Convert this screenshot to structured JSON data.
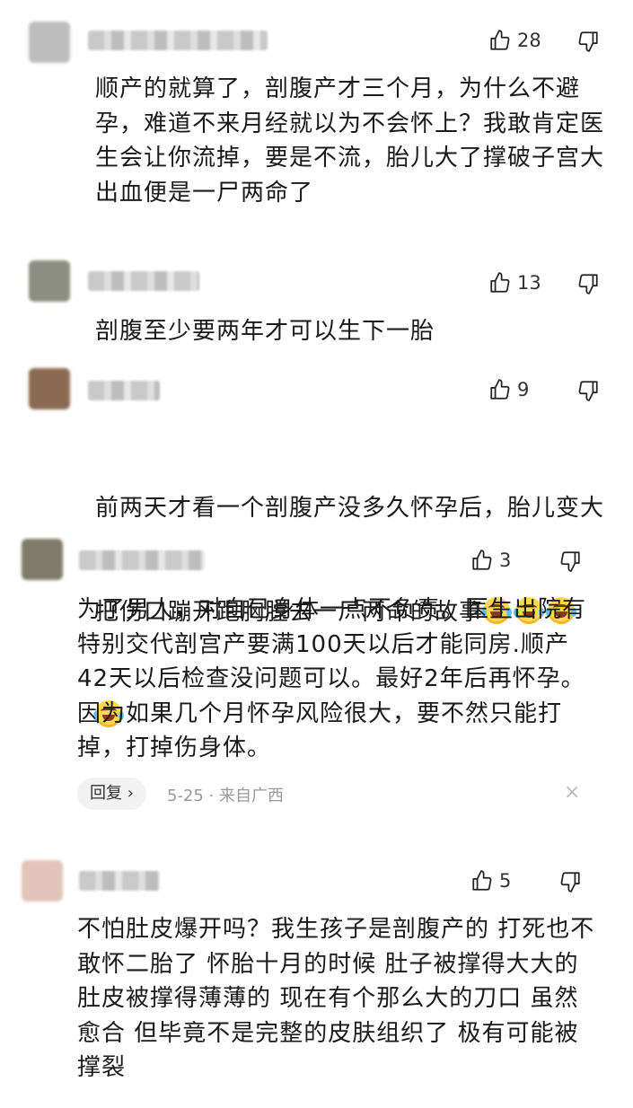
{
  "comments": [
    {
      "likes": "28",
      "text": "顺产的就算了，剖腹产才三个月，为什么不避\n孕，难道不来月经就以为不会怀上？我敢肯定医\n生会让你流掉，要是不流，胎儿大了撑破子宫大\n出血便是一尸两命了",
      "colors": {
        "avatar": "#bdbdbd"
      }
    },
    {
      "likes": "13",
      "text": "剖腹至少要两年才可以生下一胎",
      "colors": {
        "avatar": "#8c8f82"
      }
    },
    {
      "likes": "9",
      "text_line1": "前两天才看一个剖腹产没多久怀孕后，胎儿变大",
      "text_line2": "把伤口蹦开跑胸膛去一尸两命的故事",
      "emoji_icon": "crying-laughing-emoji-icon",
      "colors": {
        "avatar": "#8a6a52"
      }
    },
    {
      "likes": "3",
      "text": "为了男人，对自已身体一点不负责。医生出院有\n特别交代剖宫产要满100天以后才能同房.顺产\n42天以后检查没问题可以。最好2年后再怀孕。\n因为如果几个月怀孕风险很大，要不然只能打\n掉，打掉伤身体。",
      "reply_label": "回复 ›",
      "meta": "5-25 · 来自广西",
      "close_glyph": "×",
      "colors": {
        "avatar": "#7f7a6c"
      }
    },
    {
      "likes": "5",
      "text": "不怕肚皮爆开吗？我生孩子是剖腹产的 打死也不\n敢怀二胎了 怀胎十月的时候 肚子被撑得大大的\n肚皮被撑得薄薄的 现在有个那么大的刀口 虽然\n愈合 但毕竟不是完整的皮肤组织了 极有可能被\n撑裂",
      "colors": {
        "avatar": "#e2c4b8"
      }
    }
  ],
  "icons": {
    "like": "thumbs-up-icon",
    "dislike": "thumbs-down-icon",
    "close": "close-icon"
  }
}
